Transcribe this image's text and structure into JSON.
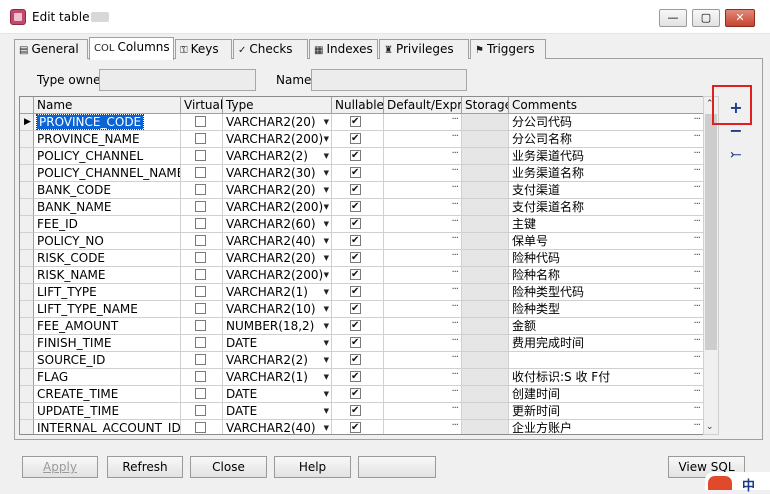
{
  "window": {
    "title": "Edit table"
  },
  "window_buttons": {
    "minimize": "—",
    "maximize": "▢",
    "close": "✕"
  },
  "tabs": [
    {
      "label": "General",
      "icon": "general-icon",
      "glyph": "▤"
    },
    {
      "label": "Columns",
      "icon": "columns-icon",
      "glyph": "COL"
    },
    {
      "label": "Keys",
      "icon": "keys-icon",
      "glyph": "⚿"
    },
    {
      "label": "Checks",
      "icon": "checks-icon",
      "glyph": "✓"
    },
    {
      "label": "Indexes",
      "icon": "indexes-icon",
      "glyph": "▦"
    },
    {
      "label": "Privileges",
      "icon": "privileges-icon",
      "glyph": "♜"
    },
    {
      "label": "Triggers",
      "icon": "triggers-icon",
      "glyph": "⚑"
    }
  ],
  "form": {
    "type_owner_label": "Type owner",
    "name_label": "Name"
  },
  "grid": {
    "headers": [
      "Name",
      "Virtual",
      "Type",
      "Nullable",
      "Default/Expr.",
      "Storage",
      "Comments"
    ],
    "rows": [
      {
        "name": "PROVINCE_CODE",
        "virtual": false,
        "type": "VARCHAR2(20)",
        "nullable": true,
        "comment": "分公司代码",
        "selected": true
      },
      {
        "name": "PROVINCE_NAME",
        "virtual": false,
        "type": "VARCHAR2(200)",
        "nullable": true,
        "comment": "分公司名称"
      },
      {
        "name": "POLICY_CHANNEL",
        "virtual": false,
        "type": "VARCHAR2(2)",
        "nullable": true,
        "comment": "业务渠道代码"
      },
      {
        "name": "POLICY_CHANNEL_NAME",
        "virtual": false,
        "type": "VARCHAR2(30)",
        "nullable": true,
        "comment": "业务渠道名称"
      },
      {
        "name": "BANK_CODE",
        "virtual": false,
        "type": "VARCHAR2(20)",
        "nullable": true,
        "comment": "支付渠道"
      },
      {
        "name": "BANK_NAME",
        "virtual": false,
        "type": "VARCHAR2(200)",
        "nullable": true,
        "comment": "支付渠道名称"
      },
      {
        "name": "FEE_ID",
        "virtual": false,
        "type": "VARCHAR2(60)",
        "nullable": true,
        "comment": "主键"
      },
      {
        "name": "POLICY_NO",
        "virtual": false,
        "type": "VARCHAR2(40)",
        "nullable": true,
        "comment": "保单号"
      },
      {
        "name": "RISK_CODE",
        "virtual": false,
        "type": "VARCHAR2(20)",
        "nullable": true,
        "comment": "险种代码"
      },
      {
        "name": "RISK_NAME",
        "virtual": false,
        "type": "VARCHAR2(200)",
        "nullable": true,
        "comment": "险种名称"
      },
      {
        "name": "LIFT_TYPE",
        "virtual": false,
        "type": "VARCHAR2(1)",
        "nullable": true,
        "comment": "险种类型代码"
      },
      {
        "name": "LIFT_TYPE_NAME",
        "virtual": false,
        "type": "VARCHAR2(10)",
        "nullable": true,
        "comment": "险种类型"
      },
      {
        "name": "FEE_AMOUNT",
        "virtual": false,
        "type": "NUMBER(18,2)",
        "nullable": true,
        "comment": "金额"
      },
      {
        "name": "FINISH_TIME",
        "virtual": false,
        "type": "DATE",
        "nullable": true,
        "comment": "费用完成时间"
      },
      {
        "name": "SOURCE_ID",
        "virtual": false,
        "type": "VARCHAR2(2)",
        "nullable": true,
        "comment": ""
      },
      {
        "name": "FLAG",
        "virtual": false,
        "type": "VARCHAR2(1)",
        "nullable": true,
        "comment": "收付标识:S 收  F付"
      },
      {
        "name": "CREATE_TIME",
        "virtual": false,
        "type": "DATE",
        "nullable": true,
        "comment": "创建时间"
      },
      {
        "name": "UPDATE_TIME",
        "virtual": false,
        "type": "DATE",
        "nullable": true,
        "comment": "更新时间"
      },
      {
        "name": "INTERNAL_ACCOUNT_ID",
        "virtual": false,
        "type": "VARCHAR2(40)",
        "nullable": true,
        "comment": "企业方账户"
      }
    ]
  },
  "side_buttons": {
    "add": "+",
    "remove": "−",
    "insert": "⤚"
  },
  "buttons": {
    "apply": "Apply",
    "refresh": "Refresh",
    "close": "Close",
    "help": "Help",
    "view_sql": "View SQL"
  },
  "ime": {
    "label": "中"
  },
  "colors": {
    "selection": "#0a64d6",
    "highlight_box": "#e02020",
    "side_icon": "#1a3a8c"
  }
}
